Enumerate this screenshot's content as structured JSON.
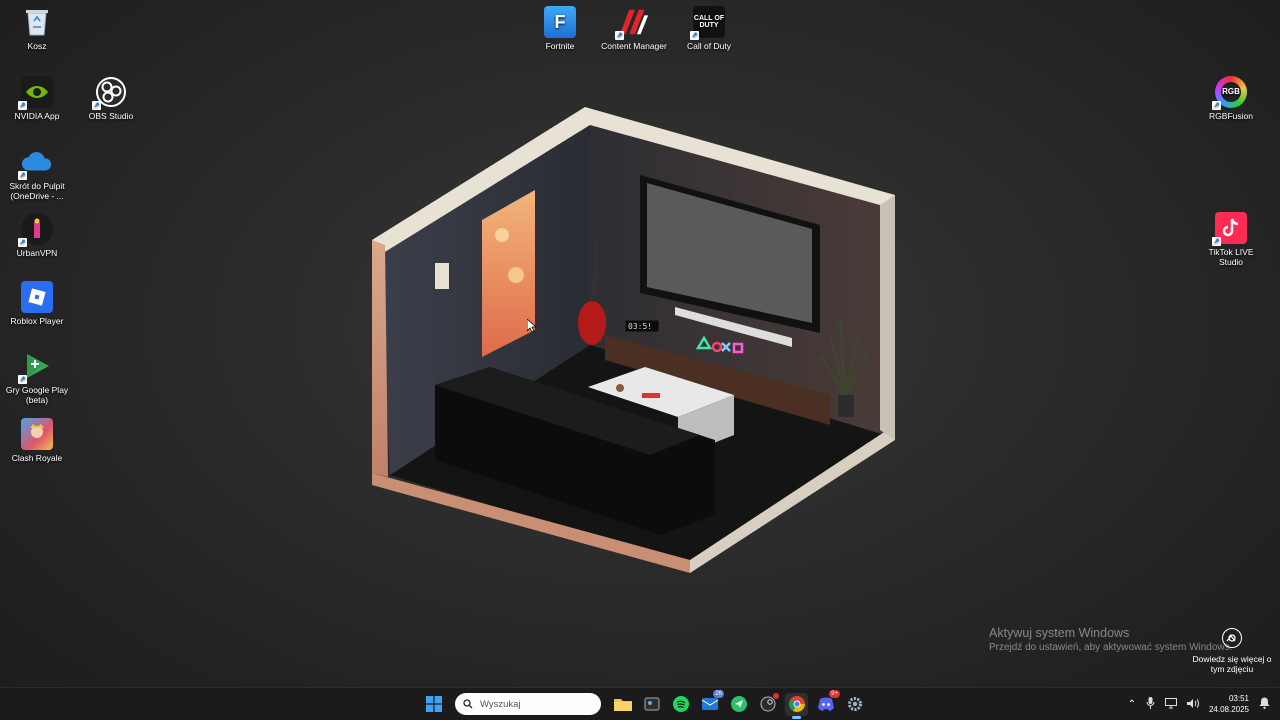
{
  "desktop": {
    "icons": {
      "kosz": "Kosz",
      "nvidia": "NVIDIA App",
      "obs": "OBS Studio",
      "onedrive": "Skrót do Pulpit (OneDrive - ...",
      "urbanvpn": "UrbanVPN",
      "roblox": "Roblox Player",
      "googleplay": "Gry Google Play (beta)",
      "clash": "Clash Royale",
      "fortnite": "Fortnite",
      "content_manager": "Content Manager",
      "cod": "Call of Duty",
      "rgbfusion": "RGBFusion",
      "tiktok": "TikTok LIVE Studio"
    },
    "icon_glyphs": {
      "fortnite": "F",
      "cod": "CALL OF DUTY",
      "rgb": "RGB"
    },
    "wallpaper": {
      "clock_display": "03:5!"
    }
  },
  "activation": {
    "title": "Aktywuj system Windows",
    "subtitle": "Przejdź do ustawień, aby aktywować system Windows.",
    "learn_more": "Dowiedz się więcej o tym zdjęciu"
  },
  "taskbar": {
    "search_placeholder": "Wyszukaj",
    "outlook_badge": "26",
    "discord_badge": "9+",
    "time": "03:51",
    "date": "24.08.2025"
  },
  "colors": {
    "taskbar_bg": "#1b1b1b",
    "active_indicator": "#7cc4ff",
    "desktop_bg": "#2a2a2a"
  }
}
